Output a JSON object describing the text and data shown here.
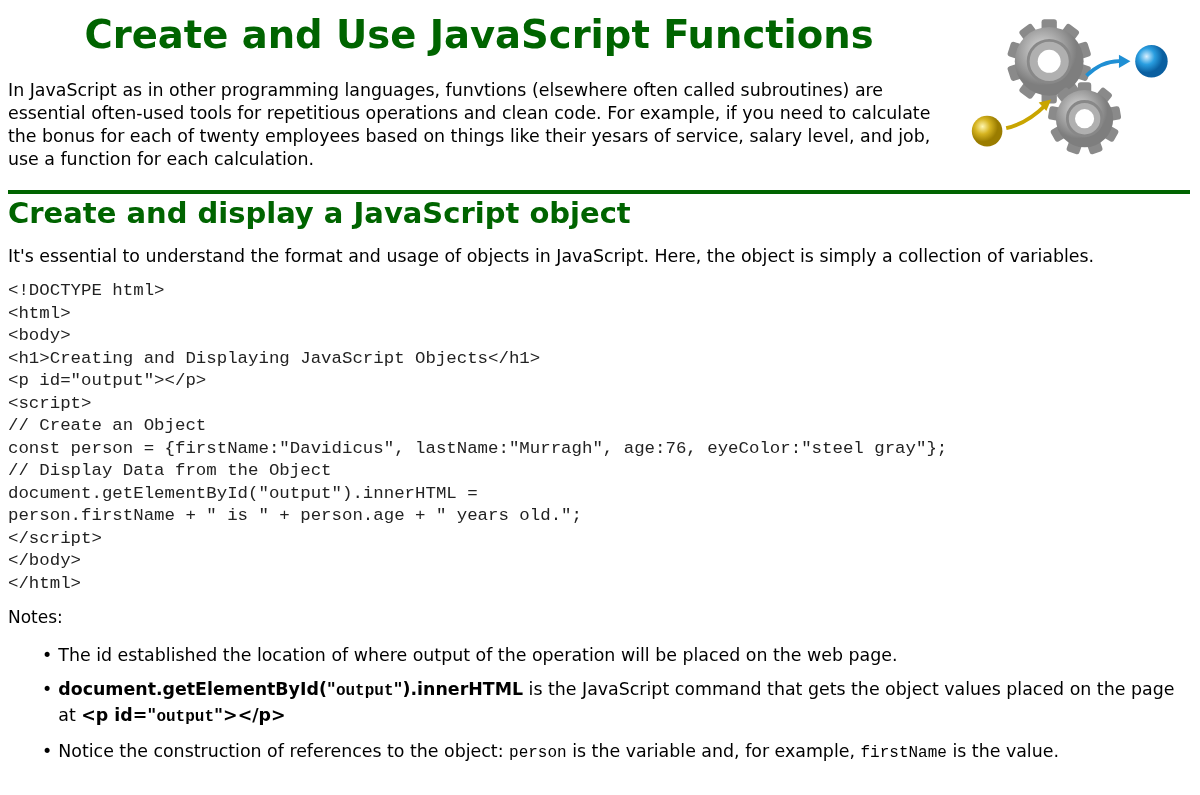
{
  "title": "Create and Use JavaScript Functions",
  "intro": "In JavaScript as in other programming languages, funvtions (elsewhere often called subroutines) are essential often-used tools for repetitious operations and clean code. For example, if you need to calculate the bonus for each of twenty employees based on things like their yesars of service, salary level, and job, use a function for each calculation.",
  "section": {
    "heading": "Create and display a JavaScript object",
    "paragraph": "It's essential to understand the format and usage of objects in JavaScript. Here, the object is simply a collection of variables.",
    "code": [
      "<!DOCTYPE html>",
      "<html>",
      "<body>",
      "<h1>Creating and Displaying JavaScript Objects</h1>",
      "<p id=\"output\"></p>",
      "<script>",
      "// Create an Object",
      "const person = {firstName:\"Davidicus\", lastName:\"Murragh\", age:76, eyeColor:\"steel gray\"};",
      "// Display Data from the Object",
      "document.getElementById(\"output\").innerHTML =",
      "person.firstName + \" is \" + person.age + \" years old.\";",
      "</script>",
      "</body>",
      "</html>"
    ],
    "notes_label": "Notes:",
    "notes": [
      {
        "bullet": "•",
        "parts": [
          {
            "kind": "plain",
            "text": "The id established the location of where output of the operation will be placed on the web page."
          }
        ]
      },
      {
        "bullet": "•",
        "parts": [
          {
            "kind": "bold",
            "text": "document.getElementById(\""
          },
          {
            "kind": "boldmono",
            "text": "output"
          },
          {
            "kind": "bold",
            "text": "\").innerHTML"
          },
          {
            "kind": "plain",
            "text": " is the JavaScript command that gets the object values placed on the page at "
          },
          {
            "kind": "bold",
            "text": "<p id=\""
          },
          {
            "kind": "boldmono",
            "text": "output"
          },
          {
            "kind": "bold",
            "text": "\"></p>"
          }
        ]
      },
      {
        "bullet": "•",
        "parts": [
          {
            "kind": "plain",
            "text": "Notice the construction of references to the object: "
          },
          {
            "kind": "mono",
            "text": "person"
          },
          {
            "kind": "plain",
            "text": " is the variable and, for example, "
          },
          {
            "kind": "mono",
            "text": "firstName"
          },
          {
            "kind": "plain",
            "text": " is the value."
          }
        ]
      }
    ]
  }
}
